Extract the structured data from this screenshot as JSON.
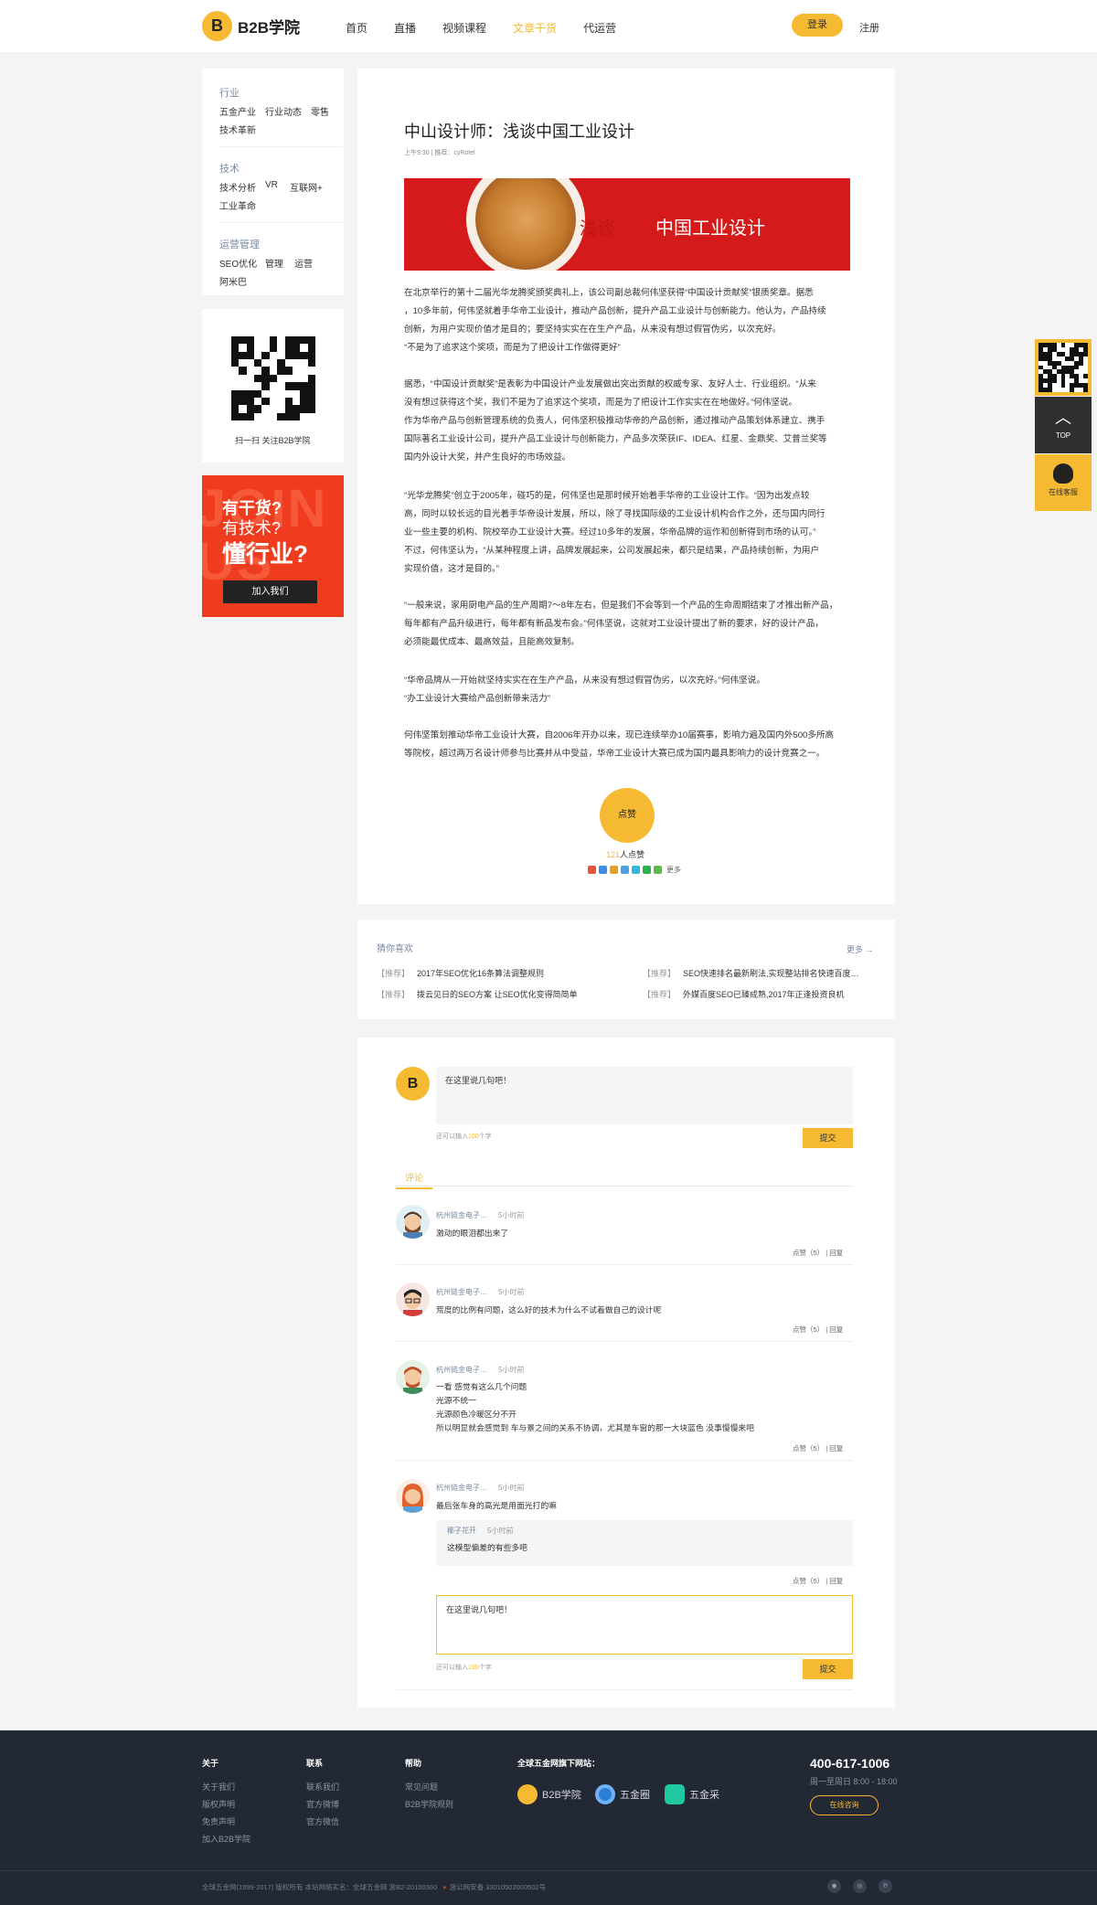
{
  "header": {
    "logo_mark": "B",
    "logo_text": "B2B学院",
    "nav": [
      "首页",
      "直播",
      "视频课程",
      "文章干货",
      "代运营"
    ],
    "active_nav": "文章干货",
    "login": "登录",
    "register": "注册"
  },
  "sidebar": {
    "groups": [
      {
        "title": "行业",
        "links": [
          "五金产业",
          "行业动态",
          "零售",
          "技术革新"
        ]
      },
      {
        "title": "技术",
        "links": [
          "技术分析",
          "VR",
          "互联网+",
          "工业革命"
        ]
      },
      {
        "title": "运营管理",
        "links": [
          "SEO优化",
          "管理",
          "运营",
          "阿米巴"
        ]
      }
    ],
    "qr_caption": "扫一扫 关注B2B学院",
    "join": {
      "bg_text": "JOIN US",
      "line1": "有干货?",
      "line2": "有技术?",
      "line3": "懂行业?",
      "button": "加入我们"
    }
  },
  "article": {
    "title": "中山设计师：浅谈中国工业设计",
    "meta": "上午9:30  |  推荐：cyRotel",
    "banner_a": "浅谈",
    "banner_b": "中国工业设计",
    "paragraphs": [
      [
        "在北京举行的第十二届光华龙腾奖颁奖典礼上，该公司副总裁何伟坚获得“中国设计贡献奖”银质奖章。据悉",
        "，10多年前，何伟坚就着手华帝工业设计，推动产品创新，提升产品工业设计与创新能力。他认为，产品持续",
        "创新，为用户实现价值才是目的；要坚持实实在在生产产品，从来没有想过假冒伪劣，以次充好。",
        "“不是为了追求这个奖项，而是为了把设计工作做得更好”"
      ],
      [
        "据悉，“中国设计贡献奖”是表彰为中国设计产业发展做出突出贡献的权威专家、友好人士、行业组织。“从来",
        "没有想过获得这个奖，我们不是为了追求这个奖项，而是为了把设计工作实实在在地做好。”何伟坚说。",
        "作为华帝产品与创新管理系统的负责人，何伟坚积极推动华帝的产品创新，通过推动产品策划体系建立、携手",
        "国际著名工业设计公司，提升产品工业设计与创新能力，产品多次荣获IF、IDEA、红星、金鼎奖、艾普兰奖等",
        "国内外设计大奖，并产生良好的市场效益。"
      ],
      [
        "“光华龙腾奖”创立于2005年，碰巧的是，何伟坚也是那时候开始着手华帝的工业设计工作。“因为出发点较",
        "高，同时以较长远的目光着手华帝设计发展，所以，除了寻找国际级的工业设计机构合作之外，还与国内同行",
        "业一些主要的机构、院校举办工业设计大赛。经过10多年的发展，华帝品牌的运作和创新得到市场的认可。”",
        "不过，何伟坚认为，“从某种程度上讲，品牌发展起来，公司发展起来，都只是结果，产品持续创新，为用户",
        "实现价值，这才是目的。”"
      ],
      [
        "“一般来说，家用厨电产品的生产周期7～8年左右，但是我们不会等到一个产品的生命周期结束了才推出新产品，",
        "每年都有产品升级进行，每年都有新品发布会。”何伟坚说，这就对工业设计提出了新的要求，好的设计产品，",
        "必须能最优成本、最高效益，且能高效复制。"
      ],
      [
        "“华帝品牌从一开始就坚持实实在在生产产品，从来没有想过假冒伪劣，以次充好。”何伟坚说。",
        "“办工业设计大赛给产品创新带来活力”"
      ],
      [
        "何伟坚策划推动华帝工业设计大赛，自2006年开办以来，现已连续举办10届赛事，影响力遍及国内外500多所高",
        "等院校，超过两万名设计师参与比赛并从中受益，华帝工业设计大赛已成为国内最具影响力的设计竞赛之一。"
      ]
    ],
    "like_label": "点赞",
    "like_count": "121",
    "like_suffix": "人点赞",
    "share_more": "更多"
  },
  "guess": {
    "title": "猜你喜欢",
    "more": "更多 →",
    "tag": "【推荐】",
    "items": [
      "2017年SEO优化16条算法调整规则",
      "SEO快速排名最新刷法,实现整站排名快速百度…",
      "拨云见日的SEO方案 让SEO优化变得简简单",
      "外媒百度SEO已臻成熟,2017年正逢投资良机"
    ]
  },
  "comments": {
    "input_placeholder": "在这里说几句吧！",
    "hint_prefix": "还可以输入",
    "hint_num": "100",
    "hint_suffix": "个字",
    "submit": "提交",
    "tab": "评论",
    "list": [
      {
        "user": "杭州链金电子…",
        "time": "5小时前",
        "lines": [
          "激动的眼泪都出来了"
        ],
        "actions": "点赞（5）  |  回复"
      },
      {
        "user": "杭州链金电子…",
        "time": "5小时前",
        "lines": [
          "荒度的比例有问题，这么好的技术为什么不试着做自己的设计呢"
        ],
        "actions": "点赞（5）  |  回复"
      },
      {
        "user": "杭州链金电子…",
        "time": "5小时前",
        "lines": [
          "一看 感觉有这么几个问题",
          "光源不统一",
          "光源颜色冷暖区分不开",
          "所以明显就会感觉到 车与景之间的关系不协调，尤其是车窗的那一大块蓝色 没事慢慢来吧"
        ],
        "actions": "点赞（5）  |  回复"
      },
      {
        "user": "杭州链金电子…",
        "time": "5小时前",
        "lines": [
          "最后张车身的高光是用面光打的嘛"
        ],
        "actions": "点赞（5）  |  回复",
        "reply": {
          "user": "椰子花开",
          "time": "5小时前",
          "text": "这模型偏差的有些多吧"
        }
      }
    ]
  },
  "footer": {
    "about": {
      "title": "关于",
      "links": [
        "关于我们",
        "版权声明",
        "免责声明",
        "加入B2B学院"
      ]
    },
    "contact": {
      "title": "联系",
      "links": [
        "联系我们",
        "官方微博",
        "官方微信"
      ]
    },
    "help": {
      "title": "帮助",
      "links": [
        "常见问题",
        "B2B学院规则"
      ]
    },
    "network_title": "全球五金网旗下网站：",
    "brands": [
      "B2B学院",
      "五金圈",
      "五金采"
    ],
    "phone": "400-617-1006",
    "hours": "周一至周日 8:00 - 18:00",
    "online": "在线咨询",
    "copyright": "全球五金网(1999-2017) 版权所有 本站网络实名：全球五金网 浙B2-20100360",
    "icp": "浙公网安备 33010502000502号"
  },
  "floating": {
    "top": "TOP",
    "service": "在线客服"
  },
  "colors": {
    "accent": "#f5b932",
    "footer_bg": "#232835",
    "join_bg": "#f03c1e",
    "banner_bg": "#d41a1a"
  }
}
